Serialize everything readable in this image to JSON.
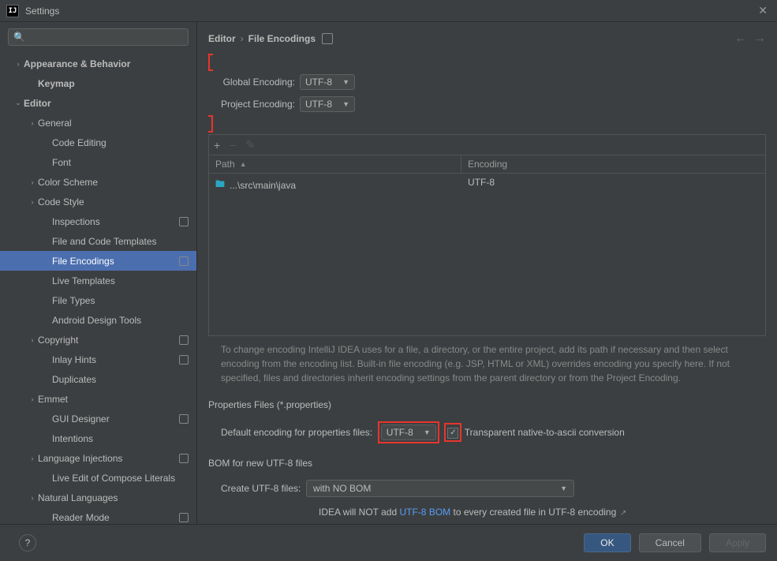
{
  "window": {
    "title": "Settings",
    "app_icon": "IJ"
  },
  "search": {
    "placeholder": ""
  },
  "tree": {
    "appearance": "Appearance & Behavior",
    "keymap": "Keymap",
    "editor": "Editor",
    "general": "General",
    "code_editing": "Code Editing",
    "font": "Font",
    "color_scheme": "Color Scheme",
    "code_style": "Code Style",
    "inspections": "Inspections",
    "file_templates": "File and Code Templates",
    "file_encodings": "File Encodings",
    "live_templates": "Live Templates",
    "file_types": "File Types",
    "android_tools": "Android Design Tools",
    "copyright": "Copyright",
    "inlay_hints": "Inlay Hints",
    "duplicates": "Duplicates",
    "emmet": "Emmet",
    "gui_designer": "GUI Designer",
    "intentions": "Intentions",
    "lang_inj": "Language Injections",
    "live_edit": "Live Edit of Compose Literals",
    "nat_lang": "Natural Languages",
    "reader_mode": "Reader Mode"
  },
  "breadcrumb": {
    "seg1": "Editor",
    "seg2": "File Encodings"
  },
  "encodings": {
    "global_label": "Global Encoding:",
    "global_value": "UTF-8",
    "project_label": "Project Encoding:",
    "project_value": "UTF-8"
  },
  "table": {
    "head_path": "Path",
    "head_enc": "Encoding",
    "rows": [
      {
        "path": "...\\src\\main\\java",
        "encoding": "UTF-8"
      }
    ]
  },
  "hint": "To change encoding IntelliJ IDEA uses for a file, a directory, or the entire project, add its path if necessary and then select encoding from the encoding list. Built-in file encoding (e.g. JSP, HTML or XML) overrides encoding you specify here. If not specified, files and directories inherit encoding settings from the parent directory or from the Project Encoding.",
  "props": {
    "section": "Properties Files (*.properties)",
    "default_label": "Default encoding for properties files:",
    "default_value": "UTF-8",
    "transparent_label": "Transparent native-to-ascii conversion"
  },
  "bom": {
    "section": "BOM for new UTF-8 files",
    "create_label": "Create UTF-8 files:",
    "create_value": "with NO BOM",
    "note_prefix": "IDEA will NOT add ",
    "note_link": "UTF-8 BOM",
    "note_suffix": " to every created file in UTF-8 encoding"
  },
  "footer": {
    "ok": "OK",
    "cancel": "Cancel",
    "apply": "Apply"
  }
}
